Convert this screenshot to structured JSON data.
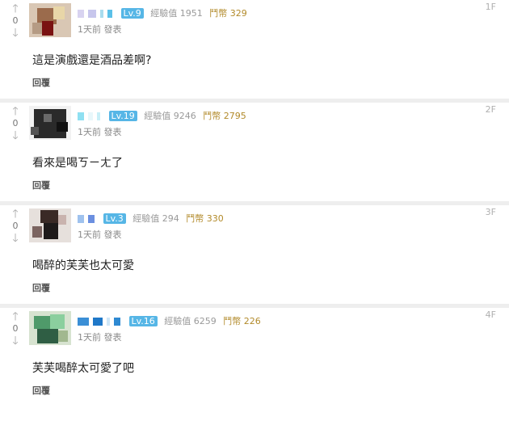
{
  "comments": [
    {
      "floor": "1F",
      "vote_count": "0",
      "level": "Lv.9",
      "exp": "經驗值 1951",
      "gp": "鬥幣 329",
      "time": "1天前 發表",
      "text": "這是演戲還是酒品差啊?",
      "reply": "回覆"
    },
    {
      "floor": "2F",
      "vote_count": "0",
      "level": "Lv.19",
      "exp": "經驗值 9246",
      "gp": "鬥幣 2795",
      "time": "1天前 發表",
      "text": "看來是喝ㄎㄧㄤ了",
      "reply": "回覆"
    },
    {
      "floor": "3F",
      "vote_count": "0",
      "level": "Lv.3",
      "exp": "經驗值 294",
      "gp": "鬥幣 330",
      "time": "1天前 發表",
      "text": "喝醉的芙芙也太可愛",
      "reply": "回覆"
    },
    {
      "floor": "4F",
      "vote_count": "0",
      "level": "Lv.16",
      "exp": "經驗值 6259",
      "gp": "鬥幣 226",
      "time": "1天前 發表",
      "text": "芙芙喝醉太可愛了吧",
      "reply": "回覆"
    }
  ],
  "icons": {
    "upvote": "up-arrow-icon",
    "downvote": "down-arrow-icon"
  },
  "colors": {
    "level_badge": "#56b6e6",
    "separator": "#eeeeee",
    "gp_text": "#b28a2a"
  }
}
